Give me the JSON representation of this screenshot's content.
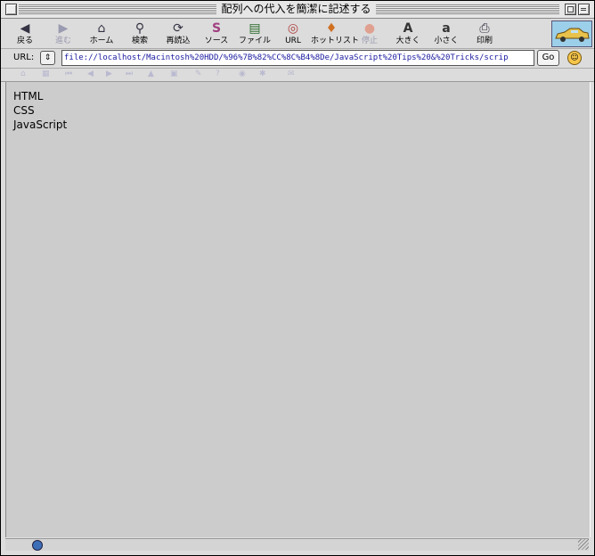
{
  "window": {
    "title": "配列への代入を簡潔に記述する"
  },
  "toolbar": {
    "items": [
      {
        "label": "戻る",
        "icon": "back-icon",
        "glyph": "◀",
        "enabled": true
      },
      {
        "label": "進む",
        "icon": "forward-icon",
        "glyph": "▶",
        "enabled": false
      },
      {
        "label": "ホーム",
        "icon": "home-icon",
        "glyph": "⌂",
        "enabled": true
      },
      {
        "label": "検索",
        "icon": "search-icon",
        "glyph": "⚲",
        "enabled": true
      },
      {
        "label": "再読込",
        "icon": "reload-icon",
        "glyph": "⟳",
        "enabled": true
      },
      {
        "label": "ソース",
        "icon": "source-icon",
        "glyph": "S",
        "enabled": true
      },
      {
        "label": "ファイル",
        "icon": "file-icon",
        "glyph": "▤",
        "enabled": true
      },
      {
        "label": "URL",
        "icon": "url-icon",
        "glyph": "◎",
        "enabled": true
      },
      {
        "label": "ホットリスト",
        "icon": "hotlist-icon",
        "glyph": "♦",
        "enabled": true
      },
      {
        "label": "停止",
        "icon": "stop-icon",
        "glyph": "●",
        "enabled": false
      },
      {
        "label": "大きく",
        "icon": "larger-text-icon",
        "glyph": "A",
        "enabled": true
      },
      {
        "label": "小さく",
        "icon": "smaller-text-icon",
        "glyph": "a",
        "enabled": true
      },
      {
        "label": "印刷",
        "icon": "print-icon",
        "glyph": "⎙",
        "enabled": true
      }
    ]
  },
  "urlbar": {
    "label": "URL:",
    "popup_glyph": "⇕",
    "value": "file://localhost/Macintosh%20HDD/%96%7B%82%CC%8C%B4%8De/JavaScript%20Tips%20&%20Tricks/scrip",
    "go_label": "Go",
    "face_glyph": "☺"
  },
  "favorites": {
    "items": [
      {
        "icon": "fav-home-icon",
        "glyph": "⌂"
      },
      {
        "icon": "fav-grid-icon",
        "glyph": "▦"
      },
      {
        "icon": "fav-first-icon",
        "glyph": "⏮"
      },
      {
        "icon": "fav-prev-icon",
        "glyph": "◀"
      },
      {
        "icon": "fav-next-icon",
        "glyph": "▶"
      },
      {
        "icon": "fav-last-icon",
        "glyph": "⏭"
      },
      {
        "icon": "fav-up-icon",
        "glyph": "▲"
      },
      {
        "icon": "fav-index-icon",
        "glyph": "▣"
      },
      {
        "icon": "fav-edit-icon",
        "glyph": "✎"
      },
      {
        "icon": "fav-help-icon",
        "glyph": "?"
      },
      {
        "icon": "fav-globe-icon",
        "glyph": "◉"
      },
      {
        "icon": "fav-gear-icon",
        "glyph": "✱"
      },
      {
        "icon": "fav-mail-icon",
        "glyph": "✉"
      }
    ]
  },
  "content": {
    "lines": [
      "HTML",
      "CSS",
      "JavaScript"
    ]
  },
  "colors": {
    "content_bg": "#cccccc",
    "url_text": "#1a1aa0",
    "car_logo_bg": "#9ccfe9"
  }
}
